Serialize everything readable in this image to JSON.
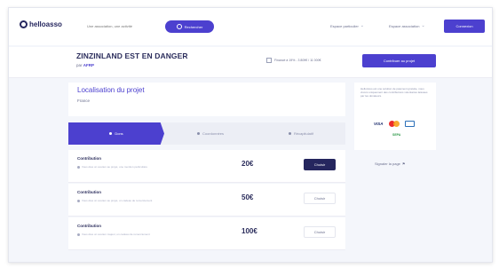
{
  "brand": {
    "name": "helloasso"
  },
  "nav": {
    "search_placeholder": "Une association, une activité",
    "search_button": "Rechercher",
    "link_individuals": "Espace particulier",
    "link_associations": "Espace association",
    "signin_label": "Connexion"
  },
  "campaign": {
    "title": "ZINZINLAND EST EN DANGER",
    "by_prefix": "par",
    "organizer": "AFRP",
    "funded_text": "Financé à 19% - 3 809€ / 11 000€",
    "contribute_button": "Contribuer au projet"
  },
  "location": {
    "title": "Localisation du projet",
    "value": "France"
  },
  "steps": [
    {
      "label": "Dons"
    },
    {
      "label": "Coordonnées"
    },
    {
      "label": "Récapitulatif"
    }
  ],
  "contributions": [
    {
      "title": "Contribution",
      "description": "Vous êtes un soutien au projet, une mention particulière",
      "amount": "20€",
      "button": "Choisir"
    },
    {
      "title": "Contribution",
      "description": "Vous êtes un soutien au projet, un cadeau de remerciement",
      "amount": "50€",
      "button": "Choisir"
    },
    {
      "title": "Contribution",
      "description": "Vous êtes un soutien majeur, un cadeau de remerciement",
      "amount": "100€",
      "button": "Choisir"
    }
  ],
  "side": {
    "info_text": "HelloAsso est une solution de paiement gratuite, nous vivons uniquement des contributions volontaires laissées par les donateurs.",
    "payment_icons": [
      "visa-icon",
      "mastercard-icon",
      "card-icon"
    ],
    "other_payment": "SEPA",
    "help_link": "Signaler la page"
  },
  "colors": {
    "accent": "#4c40cf",
    "navy": "#25265e",
    "background": "#f4f6fb"
  }
}
